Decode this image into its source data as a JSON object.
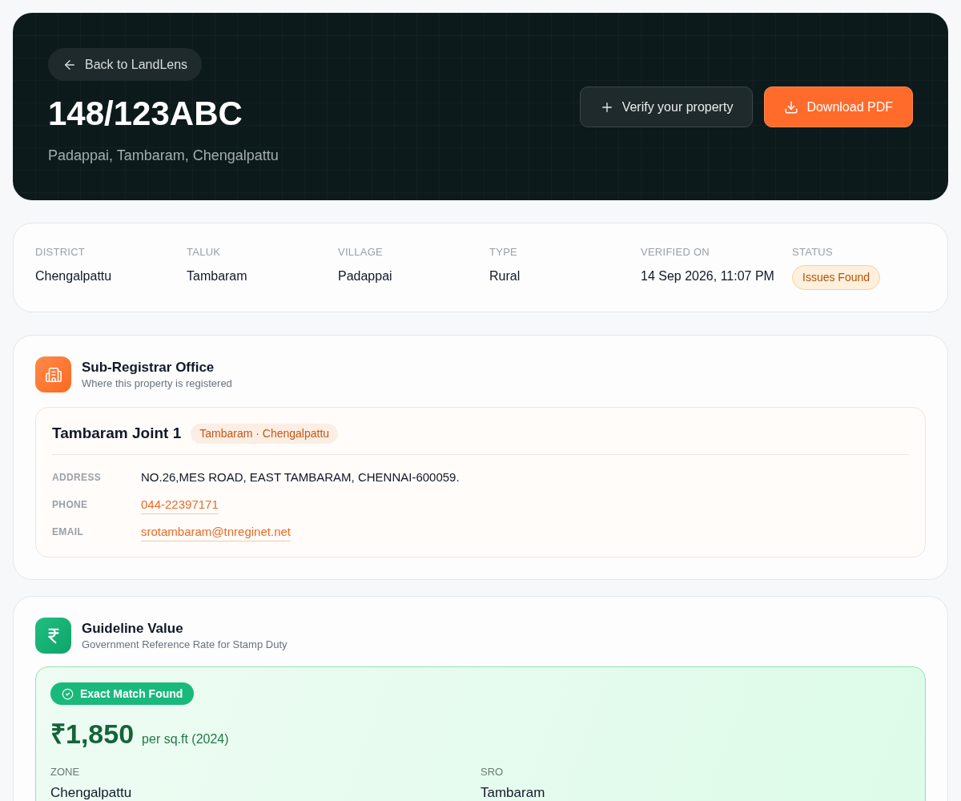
{
  "hero": {
    "back_link": "Back to LandLens",
    "title": "148/123ABC",
    "location": "Padappai, Tambaram, Chengalpattu",
    "actions": [
      {
        "kind": "secondary",
        "label": "Verify your property"
      },
      {
        "kind": "primary",
        "label": "Download PDF"
      }
    ]
  },
  "summary": {
    "fields": [
      {
        "kind": "text",
        "label": "DISTRICT",
        "value": "Chengalpattu"
      },
      {
        "kind": "text",
        "label": "TALUK",
        "value": "Tambaram"
      },
      {
        "kind": "text",
        "label": "VILLAGE",
        "value": "Padappai"
      },
      {
        "kind": "text",
        "label": "TYPE",
        "value": "Rural"
      },
      {
        "kind": "text",
        "label": "VERIFIED ON",
        "value": "14 Sep 2026, 11:07 PM"
      },
      {
        "kind": "badge",
        "label": "STATUS",
        "value": "Issues Found"
      }
    ]
  },
  "sub_registrar": {
    "title": "Sub-Registrar Office",
    "subtitle": "Where this property is registered",
    "office": {
      "name": "Tambaram Joint 1",
      "tag": "Tambaram · Chengalpattu",
      "details": [
        {
          "kind": "text",
          "label": "ADDRESS",
          "value": "NO.26,MES ROAD, EAST TAMBARAM, CHENNAI-600059."
        },
        {
          "kind": "link",
          "label": "PHONE",
          "value": "044-22397171"
        },
        {
          "kind": "link",
          "label": "EMAIL",
          "value": "srotambaram@tnreginet.net"
        }
      ]
    }
  },
  "guideline_value": {
    "title": "Guideline Value",
    "subtitle": "Government Reference Rate for Stamp Duty",
    "match_badge": "Exact Match Found",
    "price": "₹1,850",
    "unit": "per sq.ft (2024)",
    "fields": [
      {
        "label": "ZONE",
        "value": "Chengalpattu"
      },
      {
        "label": "SRO",
        "value": "Tambaram"
      }
    ]
  }
}
